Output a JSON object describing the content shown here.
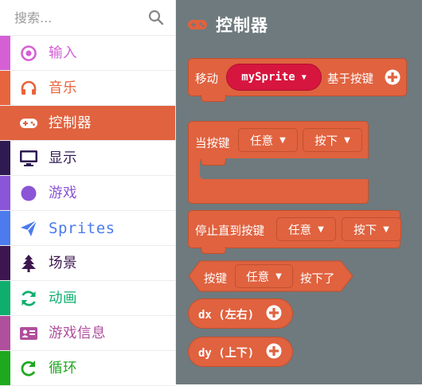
{
  "search": {
    "placeholder": "搜索..."
  },
  "categories": [
    {
      "label": "输入",
      "color": "#d460d4",
      "icon": "target-icon"
    },
    {
      "label": "音乐",
      "color": "#e8643c",
      "icon": "headphones-icon"
    },
    {
      "label": "控制器",
      "color": "#e0623f",
      "icon": "gamepad-icon",
      "active": true
    },
    {
      "label": "显示",
      "color": "#2f1b52",
      "icon": "monitor-icon"
    },
    {
      "label": "游戏",
      "color": "#8a55d6",
      "icon": "circle-icon"
    },
    {
      "label": "Sprites",
      "color": "#4b7bec",
      "icon": "paper-plane-icon"
    },
    {
      "label": "场景",
      "color": "#3d1650",
      "icon": "tree-icon"
    },
    {
      "label": "动画",
      "color": "#0fae6e",
      "icon": "refresh-icon"
    },
    {
      "label": "游戏信息",
      "color": "#b04f9c",
      "icon": "id-card-icon"
    },
    {
      "label": "循环",
      "color": "#1ea81e",
      "icon": "loop-icon"
    }
  ],
  "flyout": {
    "title": "控制器",
    "block_move": {
      "label": "移动",
      "sprite": "mySprite",
      "suffix": "基于按键"
    },
    "block_on_button": {
      "label": "当按键",
      "dd1": "任意",
      "dd2": "按下"
    },
    "block_pause": {
      "label": "停止直到按键",
      "dd1": "任意",
      "dd2": "按下"
    },
    "block_is_pressed": {
      "label": "按键",
      "dd1": "任意",
      "suffix": "按下了"
    },
    "block_dx": {
      "label": "dx (左右)"
    },
    "block_dy": {
      "label": "dy (上下)"
    }
  },
  "colors": {
    "flyout_bg": "#6e7a7e",
    "controller": "#e0623f",
    "sprite_var": "#d7163f"
  }
}
